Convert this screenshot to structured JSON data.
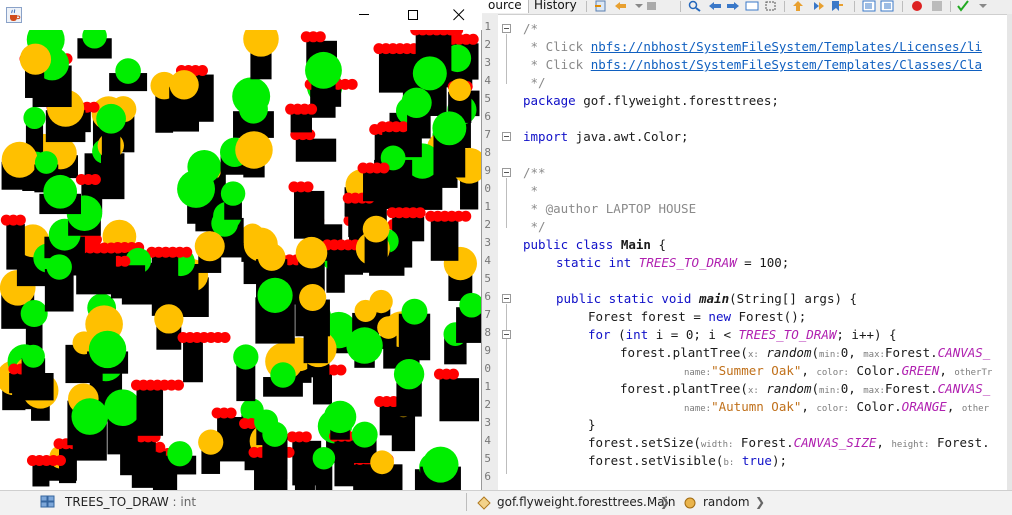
{
  "window": {
    "minimize_glyph": "—",
    "maximize_glyph": "☐",
    "close_glyph": "✕",
    "icon_name": "java-coffee-icon"
  },
  "forest": {
    "background": "#ffffff",
    "colors": {
      "green": "#00ee00",
      "orange": "#ffc000",
      "red": "#ff0000",
      "trunk": "#000000"
    }
  },
  "editor": {
    "tabs": {
      "source": "ource",
      "history": "History"
    },
    "line_numbers": [
      "1",
      "2",
      "3",
      "4",
      "5",
      "6",
      "7",
      "8",
      "9",
      "0",
      "1",
      "2",
      "3",
      "4",
      "5",
      "6",
      "7",
      "8",
      "9",
      "0",
      "1",
      "2",
      "3",
      "4",
      "5",
      "6"
    ],
    "lines": {
      "l1": "/*",
      "l2_prefix": " * Click ",
      "l2_link": "nbfs://nbhost/SystemFileSystem/Templates/Licenses/li",
      "l3_prefix": " * Click ",
      "l3_link": "nbfs://nbhost/SystemFileSystem/Templates/Classes/Cla",
      "l4": " */",
      "l5_kw": "package",
      "l5_rest": " gof.flyweight.foresttrees;",
      "l7_kw": "import",
      "l7_rest": " java.awt.Color;",
      "l9": "/**",
      "l10": " *",
      "l11": " * @author LAPTOP HOUSE",
      "l12": " */",
      "l13_kw": "public class",
      "l13_name": "Main",
      "l13_rest": " {",
      "l14_kw": "static int",
      "l14_field": "TREES_TO_DRAW",
      "l14_rest": " = 100;",
      "l16_kw": "public static void",
      "l16_method": "main",
      "l16_rest": "(String[] args) {",
      "l17_a": "Forest forest = ",
      "l17_kw": "new",
      "l17_b": " Forest();",
      "l18_kw": "for",
      "l18_a": " (",
      "l18_kw2": "int",
      "l18_b": " i = 0; i < ",
      "l18_field": "TREES_TO_DRAW",
      "l18_c": "; i++) {",
      "l19_a": "forest.plantTree(",
      "l19_hint_x": "x:",
      "l19_method": "random",
      "l19_b": "(",
      "l19_hint_min": "min:",
      "l19_c": "0, ",
      "l19_hint_max": "max:",
      "l19_d": "Forest.",
      "l19_field": "CANVAS_",
      "l20_hint_name": "name:",
      "l20_str": "\"Summer Oak\"",
      "l20_a": ", ",
      "l20_hint_color": "color:",
      "l20_b": " Color.",
      "l20_field": "GREEN",
      "l20_c": ", ",
      "l20_hint_other": "otherTr",
      "l21_a": "forest.plantTree(",
      "l21_hint_x": "x:",
      "l21_method": "random",
      "l21_b": "(",
      "l21_hint_min": "min:",
      "l21_c": "0, ",
      "l21_hint_max": "max:",
      "l21_d": "Forest.",
      "l21_field": "CANVAS_",
      "l22_hint_name": "name:",
      "l22_str": "\"Autumn Oak\"",
      "l22_a": ", ",
      "l22_hint_color": "color:",
      "l22_b": " Color.",
      "l22_field": "ORANGE",
      "l22_c": ", ",
      "l22_hint_other": "other",
      "l23": "}",
      "l24_a": "forest.setSize(",
      "l24_hint_w": "width:",
      "l24_b": " Forest.",
      "l24_field": "CANVAS_SIZE",
      "l24_c": ", ",
      "l24_hint_h": "height:",
      "l24_d": " Forest.",
      "l25_a": "forest.setVisible(",
      "l25_hint_b": "b:",
      "l25_kw": " true",
      "l25_b": ");"
    }
  },
  "status": {
    "navigator_item": "TREES_TO_DRAW",
    "navigator_type": " : int",
    "breadcrumb_class": "gof.flyweight.foresttrees.Main",
    "breadcrumb_method": "random"
  }
}
